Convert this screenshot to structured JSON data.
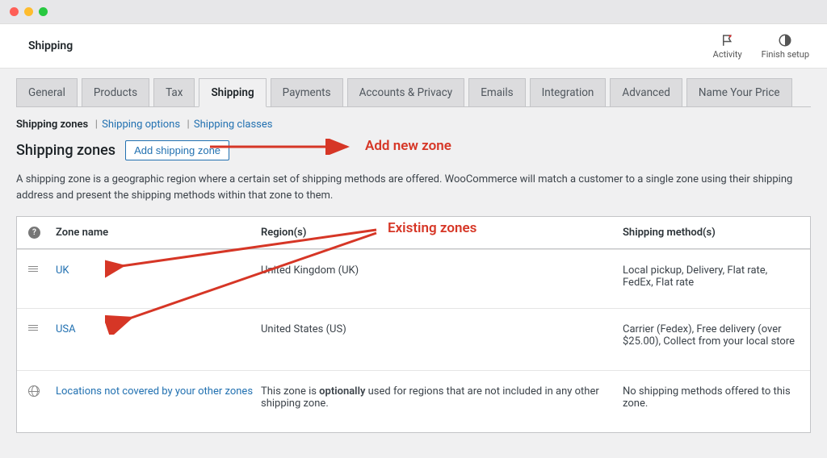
{
  "header": {
    "title": "Shipping",
    "activity_label": "Activity",
    "finish_label": "Finish setup"
  },
  "tabs": [
    "General",
    "Products",
    "Tax",
    "Shipping",
    "Payments",
    "Accounts & Privacy",
    "Emails",
    "Integration",
    "Advanced",
    "Name Your Price"
  ],
  "active_tab": "Shipping",
  "subnav": {
    "current": "Shipping zones",
    "options": "Shipping options",
    "classes": "Shipping classes"
  },
  "section": {
    "heading": "Shipping zones",
    "add_button": "Add shipping zone",
    "description": "A shipping zone is a geographic region where a certain set of shipping methods are offered. WooCommerce will match a customer to a single zone using their shipping address and present the shipping methods within that zone to them."
  },
  "table": {
    "col_name": "Zone name",
    "col_region": "Region(s)",
    "col_method": "Shipping method(s)",
    "rows": [
      {
        "name": "UK",
        "region": "United Kingdom (UK)",
        "methods": "Local pickup, Delivery, Flat rate, FedEx, Flat rate"
      },
      {
        "name": "USA",
        "region": "United States (US)",
        "methods": "Carrier (Fedex), Free delivery (over $25.00), Collect from your local store"
      }
    ],
    "fallback": {
      "name": "Locations not covered by your other zones",
      "region_prefix": "This zone is ",
      "region_bold": "optionally",
      "region_suffix": " used for regions that are not included in any other shipping zone.",
      "methods": "No shipping methods offered to this zone."
    }
  },
  "annotations": {
    "add_zone": "Add new zone",
    "existing": "Existing zones"
  }
}
